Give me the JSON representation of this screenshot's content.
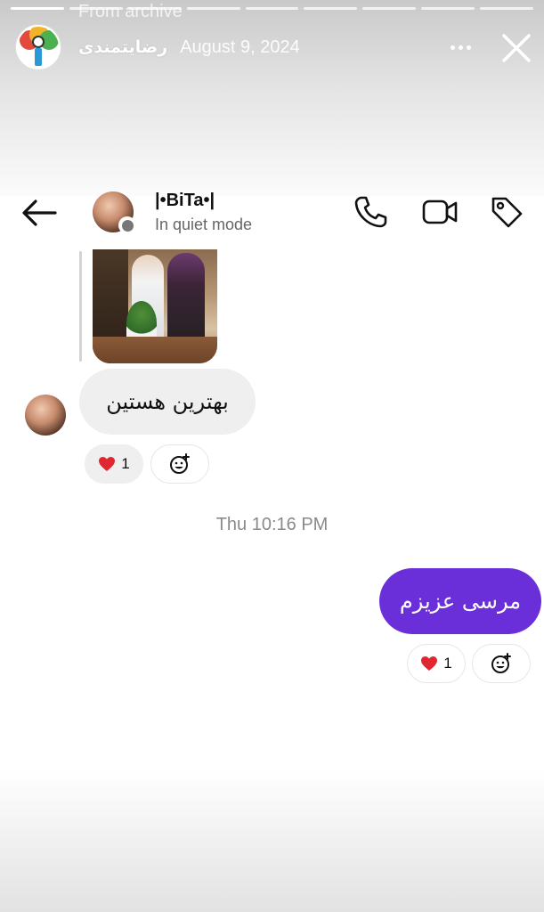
{
  "story": {
    "archive_label": "From archive",
    "username": "رضایتمندی",
    "date": "August 9, 2024",
    "progress_segments": 9,
    "progress_done": 1
  },
  "chat": {
    "contact_name": "|•BiTa•|",
    "contact_status": "In quiet mode",
    "messages": [
      {
        "direction": "incoming",
        "text": "بهترین هستین",
        "reaction": "heart",
        "reaction_count": "1"
      },
      {
        "direction": "outgoing",
        "text": "مرسی عزیزم",
        "reaction": "heart",
        "reaction_count": "1"
      }
    ],
    "timestamp": "Thu 10:16 PM"
  },
  "icons": {
    "more": "more-horizontal-icon",
    "close": "close-icon",
    "back": "arrow-left-icon",
    "call": "phone-icon",
    "video": "video-camera-icon",
    "tag": "tag-icon",
    "add_reaction": "add-reaction-icon"
  },
  "colors": {
    "outgoing_bubble": "#6a2fd8",
    "incoming_bubble": "#efefef",
    "heart": "#e0262e"
  }
}
